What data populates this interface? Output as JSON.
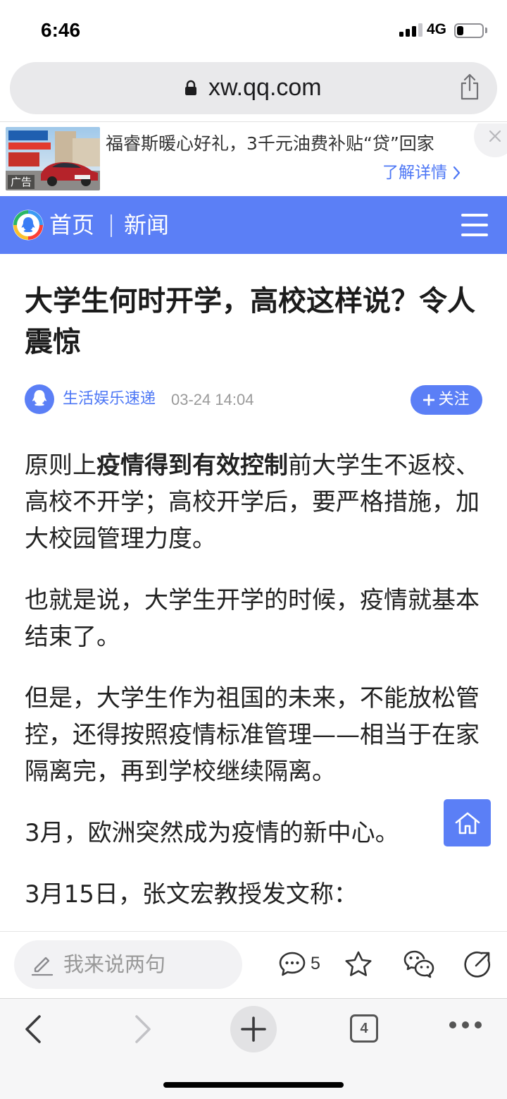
{
  "status_bar": {
    "time": "6:46",
    "network": "4G",
    "signal_bars": 3,
    "signal_bars_max": 4,
    "battery_level": 0.25,
    "icons": [
      "signal-icon",
      "battery-icon"
    ]
  },
  "address_bar": {
    "url": "xw.qq.com",
    "icons": [
      "lock-icon",
      "share-icon"
    ]
  },
  "ad_banner": {
    "badge": "广告",
    "text": "福睿斯暖心好礼，3千元油费补贴“贷”回家",
    "cta": "了解详情",
    "icons": [
      "chevron-right-icon",
      "close-icon"
    ]
  },
  "site_header": {
    "home_label": "首页",
    "section_label": "新闻",
    "icons": [
      "qq-news-logo-icon",
      "hamburger-menu-icon"
    ]
  },
  "article": {
    "title": "大学生何时开学，高校这样说？令人震惊",
    "author": "生活娱乐速递",
    "published": "03-24 14:04",
    "follow_label": "关注",
    "paragraphs": [
      {
        "segments": [
          {
            "text": "原则上",
            "bold": false
          },
          {
            "text": "疫情得到有效控制",
            "bold": true
          },
          {
            "text": "前大学生不返校、高校不开学；高校开学后，要严格措施，加大校园管理力度。",
            "bold": false
          }
        ]
      },
      {
        "segments": [
          {
            "text": "也就是说，大学生开学的时候，疫情就基本结束了。",
            "bold": false
          }
        ]
      },
      {
        "segments": [
          {
            "text": "但是，大学生作为祖国的未来，不能放松管控，还得按照疫情标准管理——相当于在家隔离完，再到学校继续隔离。",
            "bold": false
          }
        ]
      },
      {
        "segments": [
          {
            "text": "3月，欧洲突然成为疫情的新中心。",
            "bold": false
          }
        ]
      },
      {
        "segments": [
          {
            "text": "3月15日，张文宏教授发文称：",
            "bold": false
          }
        ]
      }
    ]
  },
  "floating_button": {
    "icon": "home-icon"
  },
  "comment_bar": {
    "placeholder": "我来说两句",
    "comment_count": "5",
    "icons": [
      "edit-icon",
      "comment-icon",
      "star-icon",
      "wechat-icon",
      "share-icon"
    ]
  },
  "browser_toolbar": {
    "tab_count": "4",
    "icons": [
      "back-icon",
      "forward-icon",
      "plus-icon",
      "tabs-icon",
      "more-icon"
    ]
  },
  "colors": {
    "brand": "#5b7ff6",
    "link": "#4d77f5",
    "text": "#222222",
    "muted": "#999999"
  }
}
